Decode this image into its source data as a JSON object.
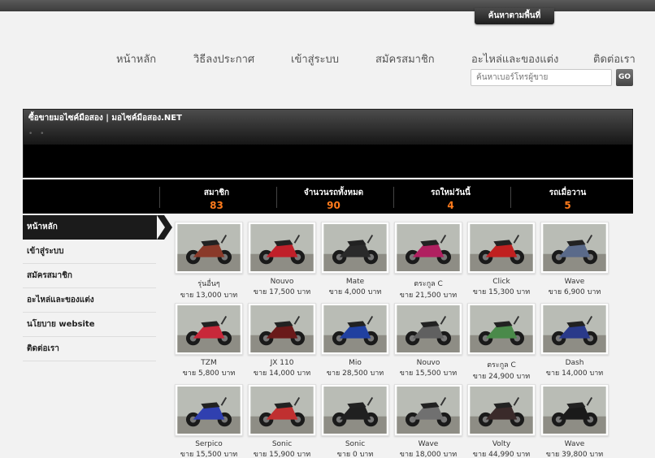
{
  "header": {
    "area_tab": "ค้นหาตามพื้นที่",
    "search_placeholder": "ค้นหาเบอร์โทรผู้ขาย",
    "go_label": "GO"
  },
  "nav": [
    {
      "label": "หน้าหลัก",
      "active": true
    },
    {
      "label": "วิธีลงประกาศ",
      "active": false
    },
    {
      "label": "เข้าสู่ระบบ",
      "active": false
    },
    {
      "label": "สมัครสมาชิก",
      "active": false
    },
    {
      "label": "อะไหล่และของแต่ง",
      "active": false
    },
    {
      "label": "ติดต่อเรา",
      "active": false
    }
  ],
  "banner": {
    "title": "ซื้อขายมอไซค์มือสอง | มอไซค์มือสอง.NET",
    "dots": "• •"
  },
  "stats": [
    {
      "label": "สมาชิก",
      "value": "83"
    },
    {
      "label": "จำนวนรถทั้งหมด",
      "value": "90"
    },
    {
      "label": "รถใหม่วันนี้",
      "value": "4"
    },
    {
      "label": "รถเมื่อวาน",
      "value": "5"
    }
  ],
  "sidebar": [
    {
      "label": "หน้าหลัก",
      "active": true
    },
    {
      "label": "เข้าสู่ระบบ",
      "active": false
    },
    {
      "label": "สมัครสมาชิก",
      "active": false
    },
    {
      "label": "อะไหล่และของแต่ง",
      "active": false
    },
    {
      "label": "นโยบาย website",
      "active": false
    },
    {
      "label": "ติดต่อเรา",
      "active": false
    }
  ],
  "listings": [
    {
      "name": "รุ่นอื่นๆ",
      "price": "ขาย 13,000 บาท",
      "color": "#8a3a2a"
    },
    {
      "name": "Nouvo",
      "price": "ขาย 17,500 บาท",
      "color": "#c0202a"
    },
    {
      "name": "Mate",
      "price": "ขาย 4,000 บาท",
      "color": "#2a2a2a"
    },
    {
      "name": "ตระกูล C",
      "price": "ขาย 21,500 บาท",
      "color": "#b02060"
    },
    {
      "name": "Click",
      "price": "ขาย 15,300 บาท",
      "color": "#c02020"
    },
    {
      "name": "Wave",
      "price": "ขาย 6,900 บาท",
      "color": "#5a6a8a"
    },
    {
      "name": "TZM",
      "price": "ขาย 5,800 บาท",
      "color": "#c8283a"
    },
    {
      "name": "JX 110",
      "price": "ขาย 14,000 บาท",
      "color": "#6a1a1a"
    },
    {
      "name": "Mio",
      "price": "ขาย 28,500 บาท",
      "color": "#2040a0"
    },
    {
      "name": "Nouvo",
      "price": "ขาย 15,500 บาท",
      "color": "#606060"
    },
    {
      "name": "ตระกูล C",
      "price": "ขาย 24,900 บาท",
      "color": "#4a8a4a"
    },
    {
      "name": "Dash",
      "price": "ขาย 14,000 บาท",
      "color": "#2a3a8a"
    },
    {
      "name": "Serpico",
      "price": "ขาย 15,500 บาท",
      "color": "#3040b0"
    },
    {
      "name": "Sonic",
      "price": "ขาย 15,900 บาท",
      "color": "#c03030"
    },
    {
      "name": "Sonic",
      "price": "ขาย 0 บาท",
      "color": "#202020"
    },
    {
      "name": "Wave",
      "price": "ขาย 18,000 บาท",
      "color": "#707070"
    },
    {
      "name": "Volty",
      "price": "ขาย 44,990 บาท",
      "color": "#3a2a2a"
    },
    {
      "name": "Wave",
      "price": "ขาย 39,800 บาท",
      "color": "#1a1a1a"
    }
  ]
}
